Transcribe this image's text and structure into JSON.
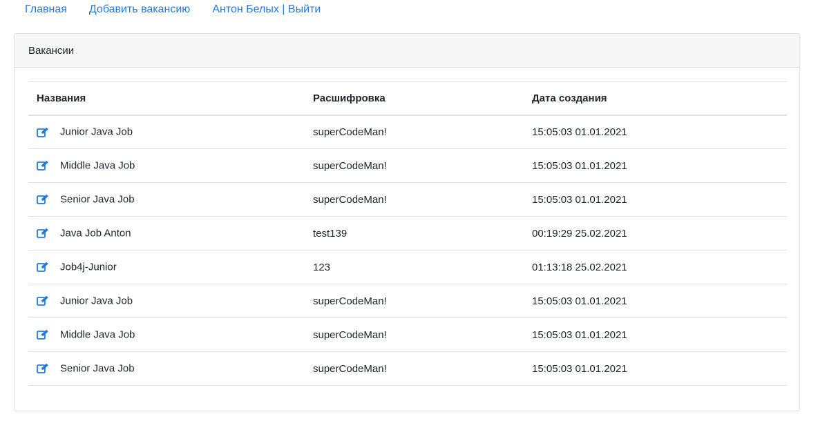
{
  "nav": {
    "home": "Главная",
    "add_vacancy": "Добавить вакансию",
    "user": "Антон Белых | Выйти"
  },
  "card": {
    "title": "Вакансии"
  },
  "table": {
    "headers": [
      "Названия",
      "Расшифровка",
      "Дата создания"
    ],
    "rows": [
      {
        "name": "Junior Java Job",
        "description": "superCodeMan!",
        "created": "15:05:03 01.01.2021"
      },
      {
        "name": "Middle Java Job",
        "description": "superCodeMan!",
        "created": "15:05:03 01.01.2021"
      },
      {
        "name": "Senior Java Job",
        "description": "superCodeMan!",
        "created": "15:05:03 01.01.2021"
      },
      {
        "name": "Java Job Anton",
        "description": "test139",
        "created": "00:19:29 25.02.2021"
      },
      {
        "name": "Job4j-Junior",
        "description": "123",
        "created": "01:13:18 25.02.2021"
      },
      {
        "name": "Junior Java Job",
        "description": "superCodeMan!",
        "created": "15:05:03 01.01.2021"
      },
      {
        "name": "Middle Java Job",
        "description": "superCodeMan!",
        "created": "15:05:03 01.01.2021"
      },
      {
        "name": "Senior Java Job",
        "description": "superCodeMan!",
        "created": "15:05:03 01.01.2021"
      }
    ]
  },
  "icons": {
    "row_action": "edit-icon"
  },
  "colors": {
    "link": "#1f7ae0",
    "icon": "#1f7ae0",
    "header_bg": "#f7f7f7"
  }
}
